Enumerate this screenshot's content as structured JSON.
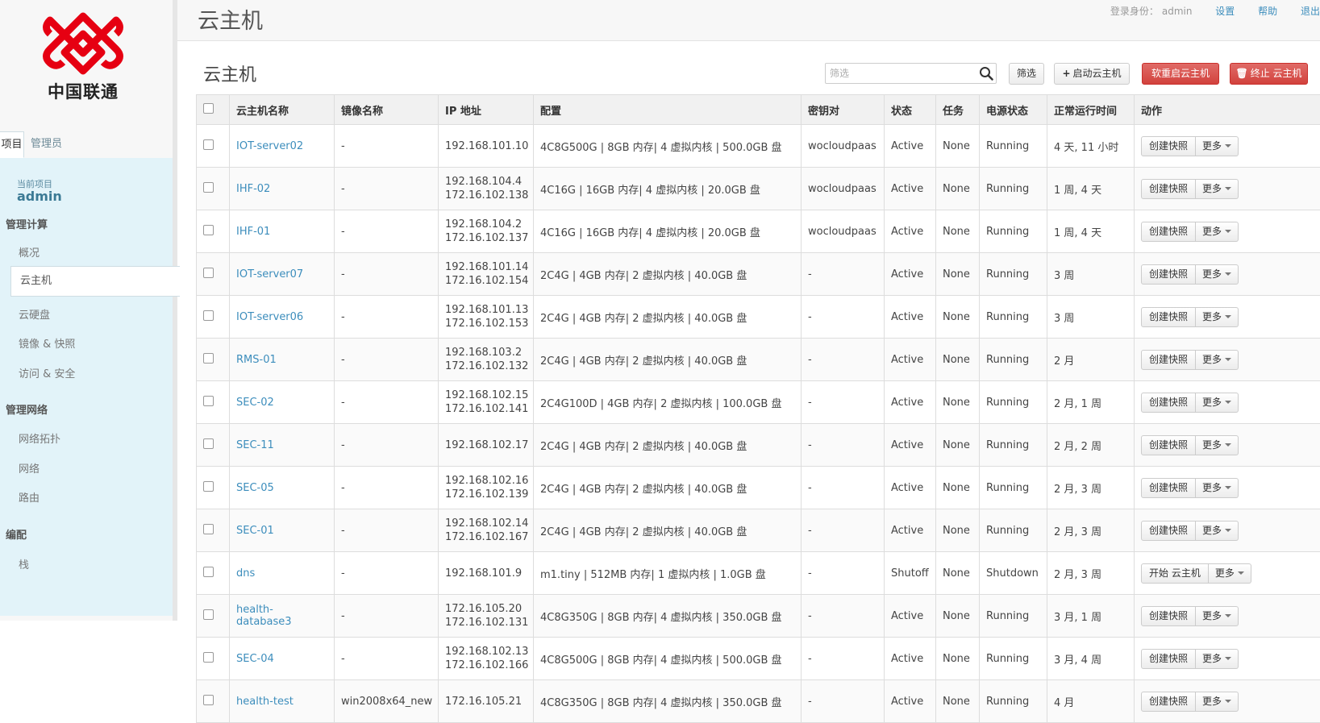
{
  "brand": {
    "name": "中国联通",
    "logo_icon": "china-unicom-knot-icon",
    "color": "#e60012"
  },
  "header": {
    "title": "云主机",
    "login_label": "登录身份：",
    "login_user": "admin",
    "settings": "设置",
    "help": "帮助",
    "logout": "退出"
  },
  "sidebar": {
    "tabs": [
      "项目",
      "管理员"
    ],
    "current_project_label": "当前项目",
    "current_project": "admin",
    "sections": [
      {
        "title": "管理计算",
        "items": [
          "概况",
          "云主机",
          "云硬盘",
          "镜像 & 快照",
          "访问 & 安全"
        ]
      },
      {
        "title": "管理网络",
        "items": [
          "网络拓扑",
          "网络",
          "路由"
        ]
      },
      {
        "title": "编配",
        "items": [
          "栈"
        ]
      }
    ],
    "active_item": "云主机"
  },
  "content": {
    "title": "云主机",
    "filter_placeholder": "筛选",
    "filter_button": "筛选",
    "launch_button": "启动云主机",
    "soft_reboot_button": "软重启云主机",
    "terminate_button": "终止 云主机"
  },
  "table": {
    "columns": [
      "云主机名称",
      "镜像名称",
      "IP 地址",
      "配置",
      "密钥对",
      "状态",
      "任务",
      "电源状态",
      "正常运行时间",
      "动作"
    ],
    "rows": [
      {
        "name": "IOT-server02",
        "image": "-",
        "ip": [
          "192.168.101.10"
        ],
        "flavor": "4C8G500G | 8GB 内存| 4 虚拟内核 | 500.0GB 盘",
        "key": "wocloudpaas",
        "status": "Active",
        "task": "None",
        "power": "Running",
        "uptime": "4 天, 11 小时",
        "action": "创建快照",
        "more": "更多"
      },
      {
        "name": "IHF-02",
        "image": "-",
        "ip": [
          "192.168.104.4",
          "172.16.102.138"
        ],
        "flavor": "4C16G | 16GB 内存| 4 虚拟内核 | 20.0GB 盘",
        "key": "wocloudpaas",
        "status": "Active",
        "task": "None",
        "power": "Running",
        "uptime": "1 周, 4 天",
        "action": "创建快照",
        "more": "更多"
      },
      {
        "name": "IHF-01",
        "image": "-",
        "ip": [
          "192.168.104.2",
          "172.16.102.137"
        ],
        "flavor": "4C16G | 16GB 内存| 4 虚拟内核 | 20.0GB 盘",
        "key": "wocloudpaas",
        "status": "Active",
        "task": "None",
        "power": "Running",
        "uptime": "1 周, 4 天",
        "action": "创建快照",
        "more": "更多"
      },
      {
        "name": "IOT-server07",
        "image": "-",
        "ip": [
          "192.168.101.14",
          "172.16.102.154"
        ],
        "flavor": "2C4G | 4GB 内存| 2 虚拟内核 | 40.0GB 盘",
        "key": "-",
        "status": "Active",
        "task": "None",
        "power": "Running",
        "uptime": "3 周",
        "action": "创建快照",
        "more": "更多"
      },
      {
        "name": "IOT-server06",
        "image": "-",
        "ip": [
          "192.168.101.13",
          "172.16.102.153"
        ],
        "flavor": "2C4G | 4GB 内存| 2 虚拟内核 | 40.0GB 盘",
        "key": "-",
        "status": "Active",
        "task": "None",
        "power": "Running",
        "uptime": "3 周",
        "action": "创建快照",
        "more": "更多"
      },
      {
        "name": "RMS-01",
        "image": "-",
        "ip": [
          "192.168.103.2",
          "172.16.102.132"
        ],
        "flavor": "2C4G | 4GB 内存| 2 虚拟内核 | 40.0GB 盘",
        "key": "-",
        "status": "Active",
        "task": "None",
        "power": "Running",
        "uptime": "2 月",
        "action": "创建快照",
        "more": "更多"
      },
      {
        "name": "SEC-02",
        "image": "-",
        "ip": [
          "192.168.102.15",
          "172.16.102.141"
        ],
        "flavor": "2C4G100D | 4GB 内存| 2 虚拟内核 | 100.0GB 盘",
        "key": "-",
        "status": "Active",
        "task": "None",
        "power": "Running",
        "uptime": "2 月, 1 周",
        "action": "创建快照",
        "more": "更多"
      },
      {
        "name": "SEC-11",
        "image": "-",
        "ip": [
          "192.168.102.17"
        ],
        "flavor": "2C4G | 4GB 内存| 2 虚拟内核 | 40.0GB 盘",
        "key": "-",
        "status": "Active",
        "task": "None",
        "power": "Running",
        "uptime": "2 月, 2 周",
        "action": "创建快照",
        "more": "更多"
      },
      {
        "name": "SEC-05",
        "image": "-",
        "ip": [
          "192.168.102.16",
          "172.16.102.139"
        ],
        "flavor": "2C4G | 4GB 内存| 2 虚拟内核 | 40.0GB 盘",
        "key": "-",
        "status": "Active",
        "task": "None",
        "power": "Running",
        "uptime": "2 月, 3 周",
        "action": "创建快照",
        "more": "更多"
      },
      {
        "name": "SEC-01",
        "image": "-",
        "ip": [
          "192.168.102.14",
          "172.16.102.167"
        ],
        "flavor": "2C4G | 4GB 内存| 2 虚拟内核 | 40.0GB 盘",
        "key": "-",
        "status": "Active",
        "task": "None",
        "power": "Running",
        "uptime": "2 月, 3 周",
        "action": "创建快照",
        "more": "更多"
      },
      {
        "name": "dns",
        "image": "-",
        "ip": [
          "192.168.101.9"
        ],
        "flavor": "m1.tiny | 512MB 内存| 1 虚拟内核 | 1.0GB 盘",
        "key": "-",
        "status": "Shutoff",
        "task": "None",
        "power": "Shutdown",
        "uptime": "2 月, 3 周",
        "action": "开始 云主机",
        "more": "更多"
      },
      {
        "name": "health-database3",
        "image": "-",
        "ip": [
          "172.16.105.20",
          "172.16.102.131"
        ],
        "flavor": "4C8G350G | 8GB 内存| 4 虚拟内核 | 350.0GB 盘",
        "key": "-",
        "status": "Active",
        "task": "None",
        "power": "Running",
        "uptime": "3 月, 1 周",
        "action": "创建快照",
        "more": "更多"
      },
      {
        "name": "SEC-04",
        "image": "-",
        "ip": [
          "192.168.102.13",
          "172.16.102.166"
        ],
        "flavor": "4C8G500G | 8GB 内存| 4 虚拟内核 | 500.0GB 盘",
        "key": "-",
        "status": "Active",
        "task": "None",
        "power": "Running",
        "uptime": "3 月, 4 周",
        "action": "创建快照",
        "more": "更多"
      },
      {
        "name": "health-test",
        "image": "win2008x64_new",
        "ip": [
          "172.16.105.21"
        ],
        "flavor": "4C8G350G | 8GB 内存| 4 虚拟内核 | 350.0GB 盘",
        "key": "-",
        "status": "Active",
        "task": "None",
        "power": "Running",
        "uptime": "4 月",
        "action": "创建快照",
        "more": "更多"
      }
    ]
  }
}
